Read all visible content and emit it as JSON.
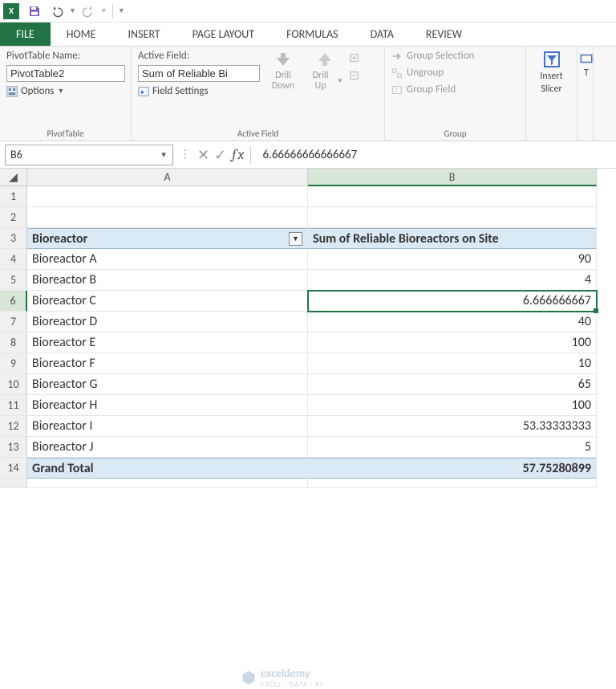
{
  "qat": {
    "app_icon_text": "X",
    "save_title": "Save",
    "undo_title": "Undo",
    "redo_title": "Redo"
  },
  "tabs": {
    "file": "FILE",
    "home": "HOME",
    "insert": "INSERT",
    "layout": "PAGE LAYOUT",
    "formulas": "FORMULAS",
    "data": "DATA",
    "review": "REVIEW"
  },
  "ribbon": {
    "pt": {
      "name_label": "PivotTable Name:",
      "name_value": "PivotTable2",
      "options_label": "Options",
      "group_label": "PivotTable"
    },
    "af": {
      "field_label": "Active Field:",
      "field_value": "Sum of Reliable Bi",
      "settings_label": "Field Settings",
      "drill_down": "Drill Down",
      "drill_up": "Drill Up",
      "group_label": "Active Field"
    },
    "grp": {
      "selection": "Group Selection",
      "ungroup": "Ungroup",
      "field": "Group Field",
      "group_label": "Group"
    },
    "slicer": {
      "label1": "Insert",
      "label2": "Slicer"
    },
    "timeline_initial": "T"
  },
  "fbar": {
    "namebox": "B6",
    "formula": "6.66666666666667"
  },
  "columns": {
    "A": "A",
    "B": "B"
  },
  "pivot": {
    "header_a": "Bioreactor",
    "header_b": "Sum of Reliable Bioreactors on Site",
    "rows": [
      {
        "label": "Bioreactor A",
        "value": "90"
      },
      {
        "label": "Bioreactor B",
        "value": "4"
      },
      {
        "label": "Bioreactor C",
        "value": "6.666666667"
      },
      {
        "label": "Bioreactor D",
        "value": "40"
      },
      {
        "label": "Bioreactor E",
        "value": "100"
      },
      {
        "label": "Bioreactor F",
        "value": "10"
      },
      {
        "label": "Bioreactor G",
        "value": "65"
      },
      {
        "label": "Bioreactor H",
        "value": "100"
      },
      {
        "label": "Bioreactor I",
        "value": "53.33333333"
      },
      {
        "label": "Bioreactor J",
        "value": "5"
      }
    ],
    "total_label": "Grand Total",
    "total_value": "57.75280899"
  },
  "watermark": {
    "brand": "exceldemy",
    "tag": "EXCEL · DATA · BI"
  }
}
